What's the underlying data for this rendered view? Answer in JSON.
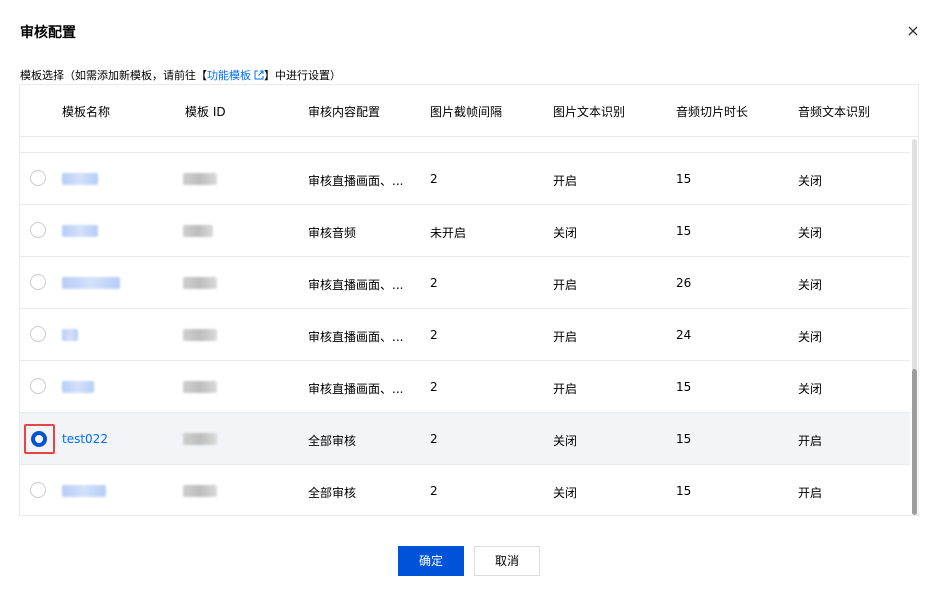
{
  "dialog": {
    "title": "审核配置"
  },
  "subtitle": {
    "prefix": "模板选择（如需添加新模板，请前往",
    "bracket_open": "【",
    "link_text": "功能模板",
    "bracket_close": "】",
    "suffix": "中进行设置）"
  },
  "table": {
    "headers": [
      "模板名称",
      "模板 ID",
      "审核内容配置",
      "图片截帧间隔",
      "图片文本识别",
      "音频切片时长",
      "音频文本识别"
    ],
    "rows": [
      {
        "name": "",
        "id": "",
        "content": "审核直播画面、...",
        "interval": "2",
        "image_ocr": "开启",
        "audio_slice": "15",
        "audio_ocr": "关闭",
        "selected": false
      },
      {
        "name": "",
        "id": "",
        "content": "审核音频",
        "interval": "未开启",
        "image_ocr": "关闭",
        "audio_slice": "15",
        "audio_ocr": "关闭",
        "selected": false
      },
      {
        "name": "",
        "id": "",
        "content": "审核直播画面、...",
        "interval": "2",
        "image_ocr": "开启",
        "audio_slice": "26",
        "audio_ocr": "关闭",
        "selected": false
      },
      {
        "name": "",
        "id": "",
        "content": "审核直播画面、...",
        "interval": "2",
        "image_ocr": "开启",
        "audio_slice": "24",
        "audio_ocr": "关闭",
        "selected": false
      },
      {
        "name": "",
        "id": "",
        "content": "审核直播画面、...",
        "interval": "2",
        "image_ocr": "开启",
        "audio_slice": "15",
        "audio_ocr": "关闭",
        "selected": false
      },
      {
        "name": "test022",
        "id": "",
        "content": "全部审核",
        "interval": "2",
        "image_ocr": "关闭",
        "audio_slice": "15",
        "audio_ocr": "开启",
        "selected": true
      },
      {
        "name": "",
        "id": "",
        "content": "全部审核",
        "interval": "2",
        "image_ocr": "关闭",
        "audio_slice": "15",
        "audio_ocr": "开启",
        "selected": false
      }
    ]
  },
  "footer": {
    "confirm_label": "确定",
    "cancel_label": "取消"
  },
  "colors": {
    "primary": "#0052d9",
    "link": "#006eff",
    "highlight": "#e54545"
  },
  "icons": {
    "close": "close-icon",
    "external_link": "external-link-icon"
  }
}
